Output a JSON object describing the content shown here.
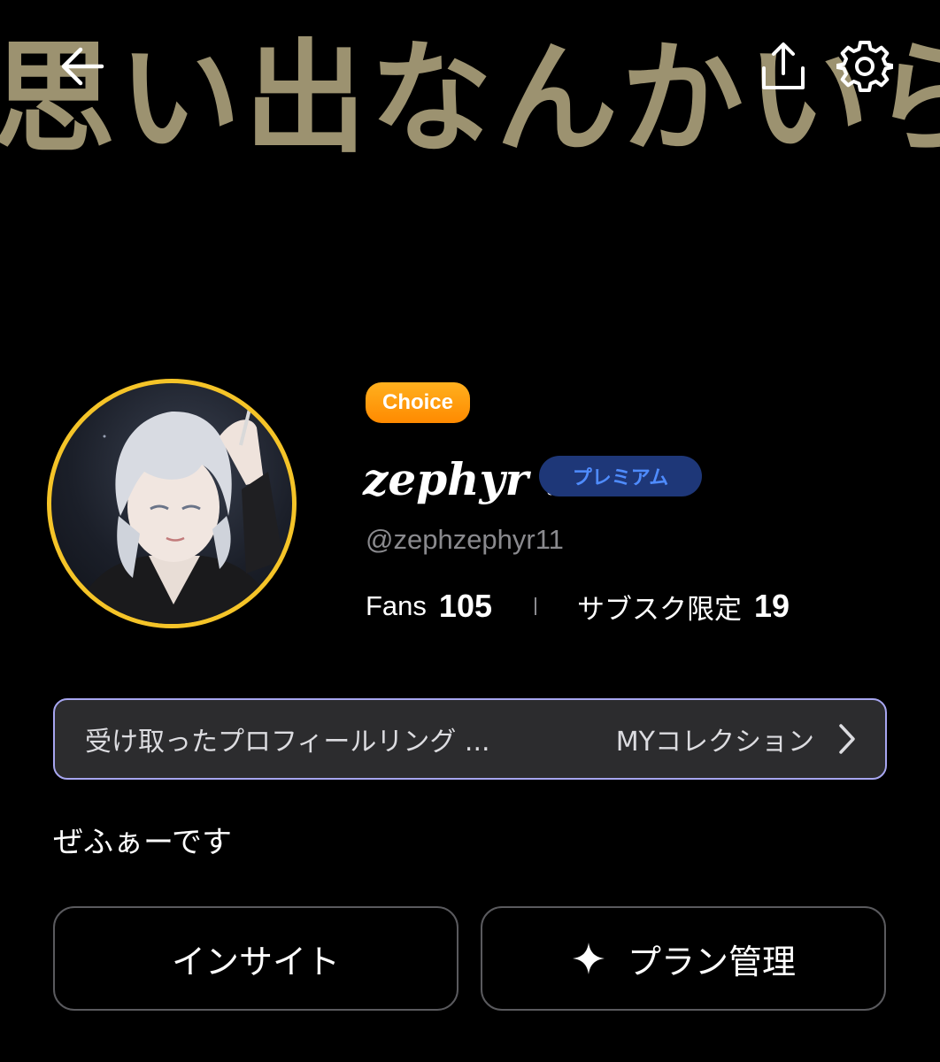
{
  "banner": {
    "text": "思い出なんかいらん"
  },
  "header": {
    "back_icon": "arrow-left-icon",
    "share_icon": "share-icon",
    "settings_icon": "gear-icon"
  },
  "profile": {
    "choice_badge": "Choice",
    "display_name": "zephyr .",
    "premium_badge": "プレミアム",
    "handle": "@zephzephyr11",
    "avatar_ring_color": "#f5c428",
    "stats": {
      "fans_label": "Fans",
      "fans_value": "105",
      "subscription_label": "サブスク限定",
      "subscription_value": "19"
    }
  },
  "collection": {
    "text": "受け取ったプロフィールリング ...",
    "link_label": "MYコレクション",
    "chevron_icon": "chevron-right-icon"
  },
  "bio": "ぜふぁーです",
  "actions": {
    "insight_label": "インサイト",
    "plan_label": "プラン管理",
    "plan_icon": "sparkle-icon"
  },
  "colors": {
    "background": "#000000",
    "banner_text": "#9c9270",
    "choice_badge": "#ff9a10",
    "premium_bg": "#1e3778",
    "premium_text": "#4f8cff",
    "collection_border": "#a7a6f0"
  }
}
